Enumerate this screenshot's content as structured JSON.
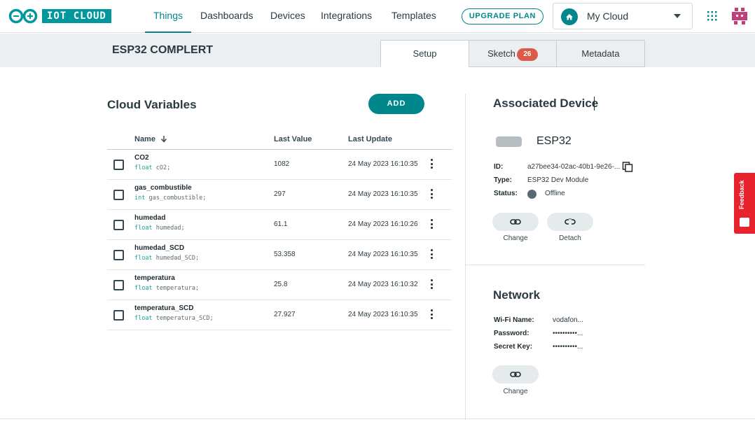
{
  "app": {
    "logo_text": "IOT CLOUD"
  },
  "nav": {
    "links": [
      "Things",
      "Dashboards",
      "Devices",
      "Integrations",
      "Templates"
    ],
    "active": "Things",
    "upgrade_label": "UPGRADE PLAN",
    "space_label": "My Cloud"
  },
  "thing": {
    "title": "ESP32 COMPLERT",
    "tabs": [
      {
        "label": "Setup",
        "active": true
      },
      {
        "label": "Sketch",
        "badge": "26"
      },
      {
        "label": "Metadata"
      }
    ]
  },
  "variables": {
    "heading": "Cloud Variables",
    "add_label": "ADD",
    "columns": {
      "name": "Name",
      "sort_icon": "arrow-down-icon",
      "last_value": "Last Value",
      "last_update": "Last Update"
    },
    "rows": [
      {
        "name": "CO2",
        "type": "float",
        "decl": " cO2;",
        "value": "1082",
        "updated": "24 May 2023 16:10:35"
      },
      {
        "name": "gas_combustible",
        "type": "int",
        "decl": " gas_combustible;",
        "value": "297",
        "updated": "24 May 2023 16:10:35"
      },
      {
        "name": "humedad",
        "type": "float",
        "decl": " humedad;",
        "value": "61.1",
        "updated": "24 May 2023 16:10:26"
      },
      {
        "name": "humedad_SCD",
        "type": "float",
        "decl": " humedad_SCD;",
        "value": "53.358",
        "updated": "24 May 2023 16:10:35"
      },
      {
        "name": "temperatura",
        "type": "float",
        "decl": " temperatura;",
        "value": "25.8",
        "updated": "24 May 2023 16:10:32"
      },
      {
        "name": "temperatura_SCD",
        "type": "float",
        "decl": " temperatura_SCD;",
        "value": "27.927",
        "updated": "24 May 2023 16:10:35"
      }
    ]
  },
  "device": {
    "heading": "Associated Device",
    "name": "ESP32",
    "id_label": "ID:",
    "id_value": "a27bee34-02ac-40b1-9e26-...",
    "type_label": "Type:",
    "type_value": "ESP32 Dev Module",
    "status_label": "Status:",
    "status_value": "Offline",
    "status_color": "#5b6a72",
    "change_label": "Change",
    "detach_label": "Detach"
  },
  "network": {
    "heading": "Network",
    "wifi_label": "Wi-Fi Name:",
    "wifi_value": "vodafon...",
    "password_label": "Password:",
    "password_value": "••••••••••...",
    "secret_label": "Secret Key:",
    "secret_value": "••••••••••...",
    "change_label": "Change"
  },
  "feedback_label": "Feedback",
  "colors": {
    "brand": "#00878c",
    "badge": "#da5b4a",
    "feedback": "#e8232e"
  }
}
